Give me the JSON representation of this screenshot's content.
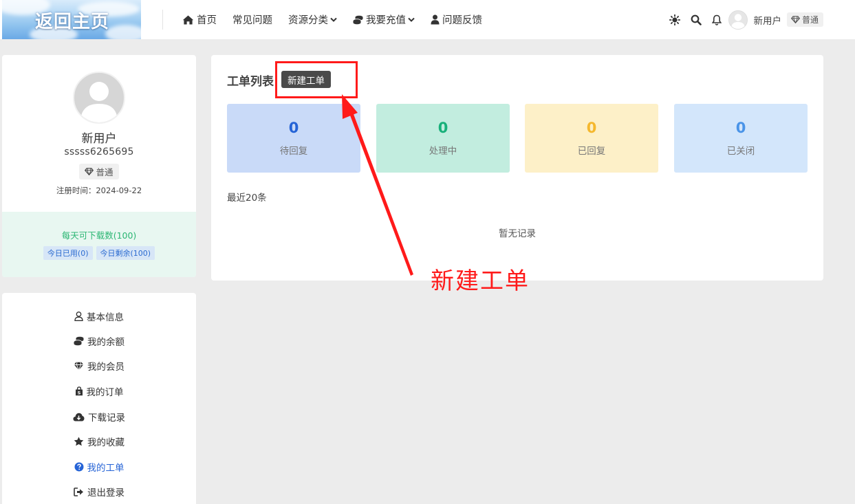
{
  "header": {
    "logo_text": "返回主页",
    "nav": [
      {
        "label": "首页",
        "icon": "home-icon"
      },
      {
        "label": "常见问题"
      },
      {
        "label": "资源分类",
        "dropdown": true
      },
      {
        "label": "我要充值",
        "icon": "coins-icon",
        "dropdown": true
      },
      {
        "label": "问题反馈",
        "icon": "user-icon"
      }
    ],
    "user_name": "新用户",
    "user_level": "普通"
  },
  "profile": {
    "name": "新用户",
    "username": "sssss6265695",
    "level": "普通",
    "register_time": "注册时间：2024-09-22",
    "daily_quota": "每天可下载数(100)",
    "used_today": "今日已用(0)",
    "remaining_today": "今日剩余(100)"
  },
  "menu": [
    {
      "label": "基本信息",
      "icon": "user-outline-icon"
    },
    {
      "label": "我的余额",
      "icon": "coins-icon"
    },
    {
      "label": "我的会员",
      "icon": "diamond-icon"
    },
    {
      "label": "我的订单",
      "icon": "shopping-bag-icon"
    },
    {
      "label": "下载记录",
      "icon": "cloud-download-icon"
    },
    {
      "label": "我的收藏",
      "icon": "star-icon"
    },
    {
      "label": "我的工单",
      "icon": "question-circle-icon",
      "active": true
    },
    {
      "label": "退出登录",
      "icon": "sign-out-icon"
    }
  ],
  "tickets": {
    "title": "工单列表",
    "new_button": "新建工单",
    "stats": [
      {
        "value": "0",
        "label": "待回复",
        "bg": "#c9daf8",
        "color": "#2563d6"
      },
      {
        "value": "0",
        "label": "处理中",
        "bg": "#c2eddf",
        "color": "#18b07a"
      },
      {
        "value": "0",
        "label": "已回复",
        "bg": "#fdf0c8",
        "color": "#f5b82e"
      },
      {
        "value": "0",
        "label": "已关闭",
        "bg": "#d3e6fb",
        "color": "#4a94e8"
      }
    ],
    "recent_label": "最近20条",
    "empty_text": "暂无记录"
  },
  "annotation": {
    "text": "新建工单",
    "color": "#ff1a1a"
  }
}
